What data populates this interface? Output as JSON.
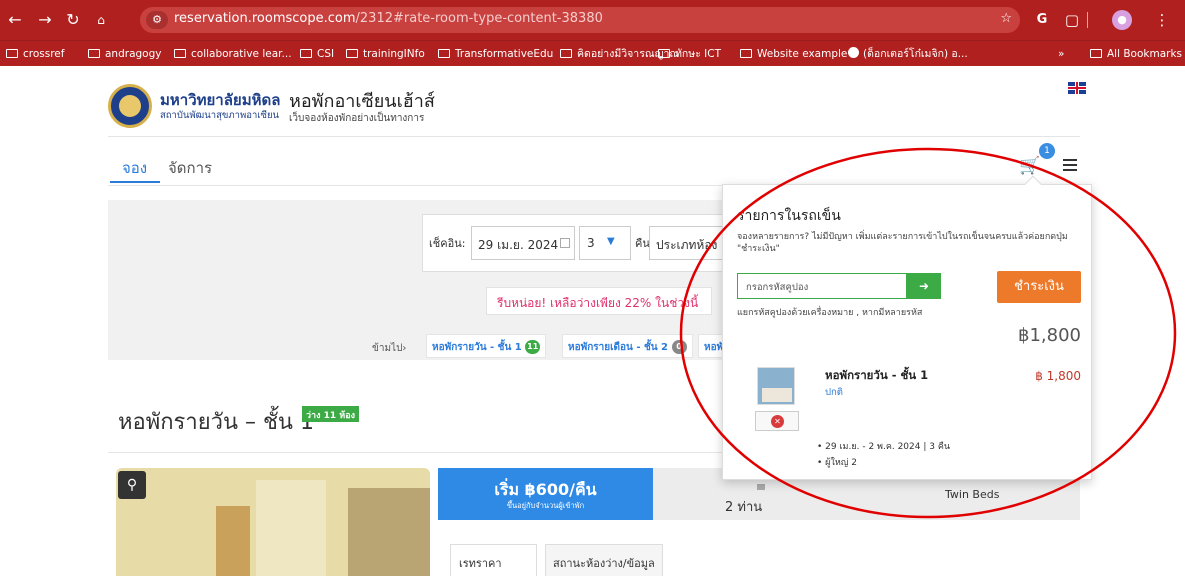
{
  "browser": {
    "url_host": "reservation.roomscope.com",
    "url_path": "/2312#rate-room-type-content-38380",
    "bookmarks": [
      "crossref",
      "andragogy",
      "collaborative lear...",
      "CSI",
      "trainingINfo",
      "TransformativeEdu",
      "คิดอย่างมีวิจารณญาณ",
      "ทักษะ ICT",
      "Website example",
      "(ด็อกเตอร์โก๋เมจิก) อ...",
      "All Bookmarks"
    ],
    "more_bookmarks": "»"
  },
  "header": {
    "university_name": "มหาวิทยาลัยมหิดล",
    "institute": "สถาบันพัฒนาสุขภาพอาเซียน",
    "site_title": "หอพักอาเซียนเฮ้าส์",
    "site_subtitle": "เว็บจองห้องพักอย่างเป็นทางการ"
  },
  "nav": {
    "book": "จอง",
    "manage": "จัดการ",
    "cart_count": "1"
  },
  "search": {
    "checkin_label": "เช็คอิน:",
    "checkin_date": "29 เม.ย. 2024",
    "nights": "3",
    "nights_label": "คืน",
    "room_type": "ประเภทห้อง"
  },
  "promo": "รีบหน่อย! เหลือว่างเพียง 22% ในช่วงนี้",
  "jump": {
    "label": "ข้ามไป›",
    "items": [
      {
        "label": "หอพักรายวัน - ชั้น 1",
        "badge": "11"
      },
      {
        "label": "หอพักรายเดือน - ชั้น 2",
        "badge": "0"
      },
      {
        "label": "หอพั",
        "badge": ""
      }
    ]
  },
  "room": {
    "title": "หอพักรายวัน – ชั้น 1",
    "availability": "ว่าง 11 ห้อง",
    "price": "เริ่ม ฿600/คืน",
    "price_note": "ขึ้นอยู่กับจำนวนผู้เข้าพัก",
    "guests": "2 ท่าน",
    "beds": "Twin Beds",
    "tabs": [
      "เรทราคา",
      "สถานะห้องว่าง/ข้อมูลห้อง"
    ]
  },
  "cart": {
    "heading": "รายการในรถเข็น",
    "help": "จองหลายรายการ? ไม่มีปัญหา เพิ่มแต่ละรายการเข้าไปในรถเข็นจนครบแล้วค่อยกดปุ่ม \"ชำระเงิน\"",
    "coupon_placeholder": "กรอกรหัสคูปอง",
    "coupon_hint": "แยกรหัสคูปองด้วยเครื่องหมาย , หากมีหลายรหัส",
    "pay_label": "ชำระเงิน",
    "total": "฿1,800",
    "item": {
      "name": "หอพักรายวัน - ชั้น 1",
      "rate": "ปกติ",
      "price": "฿ 1,800",
      "dates": "• 29 เม.ย. - 2 พ.ค. 2024 | 3 คืน",
      "adults": "• ผู้ใหญ่ 2"
    }
  },
  "colors": {
    "chrome": "#b0201f",
    "accent": "#2b7bd9",
    "pay": "#ed7a2b",
    "annotation": "#e00000"
  }
}
